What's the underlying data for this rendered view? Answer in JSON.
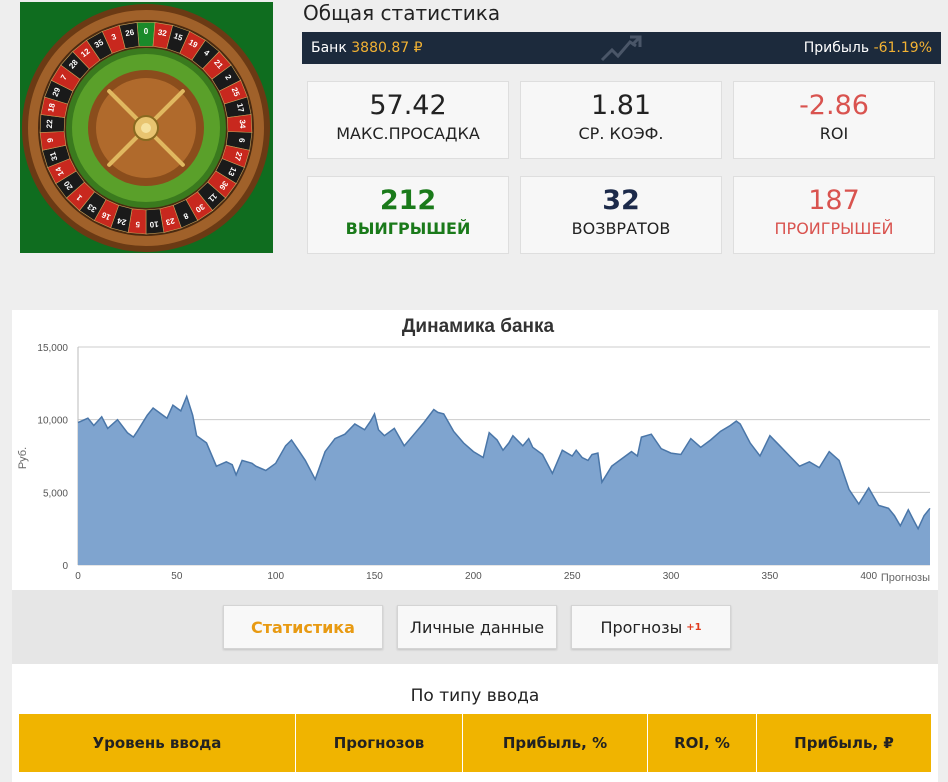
{
  "header": {
    "title": "Общая статистика",
    "bank_label": "Банк",
    "bank_value": "3880.87 ₽",
    "profit_label": "Прибыль",
    "profit_value": "-61.19%"
  },
  "stats": [
    {
      "value": "57.42",
      "label": "МАКС.ПРОСАДКА",
      "color": "#222222"
    },
    {
      "value": "1.81",
      "label": "СР. КОЭФ.",
      "color": "#222222"
    },
    {
      "value": "-2.86",
      "label": "ROI",
      "color": "#d9534f"
    },
    {
      "value": "212",
      "label": "ВЫИГРЫШЕЙ",
      "color": "#1a7a1a"
    },
    {
      "value": "32",
      "label": "ВОЗВРАТОВ",
      "color": "#1c2a4a"
    },
    {
      "value": "187",
      "label": "ПРОИГРЫШЕЙ",
      "color": "#d9534f"
    }
  ],
  "avatar": {
    "numbers": [
      "0",
      "32",
      "15",
      "19",
      "4",
      "21",
      "2",
      "25",
      "17",
      "34",
      "6",
      "27",
      "13",
      "36",
      "11",
      "30",
      "8",
      "23",
      "10",
      "5",
      "24",
      "16",
      "33",
      "1",
      "20",
      "14",
      "31",
      "9",
      "22",
      "18",
      "29",
      "7",
      "28",
      "12",
      "35",
      "3",
      "26"
    ]
  },
  "chart_data": {
    "type": "area",
    "title": "Динамика банка",
    "xlabel": "Прогнозы",
    "ylabel": "Руб.",
    "xlim": [
      0,
      431
    ],
    "ylim": [
      0,
      15000
    ],
    "x_ticks": [
      "0",
      "50",
      "100",
      "150",
      "200",
      "250",
      "300",
      "350",
      "400"
    ],
    "y_ticks": [
      "0",
      "5,000",
      "10,000",
      "15,000"
    ],
    "series": [
      {
        "x": [
          0,
          5,
          8,
          12,
          15,
          20,
          25,
          28,
          30,
          35,
          38,
          42,
          45,
          48,
          52,
          55,
          58,
          60,
          62,
          65,
          70,
          75,
          78,
          80,
          83,
          88,
          90,
          95,
          100,
          105,
          108,
          112,
          115,
          120,
          125,
          130,
          135,
          140,
          145,
          148,
          150,
          152,
          155,
          160,
          165,
          170,
          175,
          180,
          182,
          185,
          190,
          195,
          200,
          205,
          208,
          212,
          215,
          218,
          220,
          225,
          228,
          230,
          235,
          240,
          245,
          250,
          252,
          255,
          258,
          260,
          263,
          265,
          270,
          275,
          280,
          283,
          285,
          290,
          295,
          300,
          305,
          310,
          315,
          320,
          325,
          330,
          333,
          335,
          340,
          345,
          350,
          355,
          360,
          365,
          370,
          375,
          380,
          385,
          390,
          395,
          400,
          405,
          410,
          413,
          416,
          420,
          423,
          425,
          428,
          431
        ],
        "values": [
          9800,
          10100,
          9600,
          10200,
          9400,
          10000,
          9100,
          8800,
          9200,
          10300,
          10800,
          10400,
          10100,
          11000,
          10600,
          11600,
          10300,
          8900,
          8700,
          8400,
          6800,
          7100,
          6900,
          6200,
          7200,
          7000,
          6800,
          6500,
          7000,
          8200,
          8600,
          7800,
          7200,
          5900,
          7800,
          8700,
          9000,
          9700,
          9300,
          9900,
          10400,
          9300,
          8900,
          9400,
          8200,
          9000,
          9800,
          10700,
          10500,
          10400,
          9200,
          8400,
          7800,
          7400,
          9100,
          8600,
          7900,
          8400,
          8900,
          8200,
          8700,
          8100,
          7600,
          6300,
          7900,
          7500,
          7900,
          7400,
          7200,
          7600,
          7700,
          5700,
          6800,
          7300,
          7800,
          7500,
          8800,
          9000,
          8000,
          7700,
          7600,
          8700,
          8100,
          8600,
          9200,
          9600,
          9900,
          9700,
          8400,
          7500,
          8900,
          8200,
          7500,
          6800,
          7100,
          6700,
          7800,
          7200,
          5200,
          4200,
          5300,
          4100,
          3900,
          3400,
          2700,
          3800,
          3000,
          2500,
          3400,
          3900
        ]
      }
    ]
  },
  "tabs": [
    {
      "label": "Статистика",
      "badge": ""
    },
    {
      "label": "Личные данные",
      "badge": ""
    },
    {
      "label": "Прогнозы",
      "badge": "+1"
    }
  ],
  "table": {
    "section_title": "По типу ввода",
    "columns": [
      "Уровень ввода",
      "Прогнозов",
      "Прибыль, %",
      "ROI, %",
      "Прибыль, ₽"
    ]
  },
  "colors": {
    "accent": "#f0b400",
    "area_fill": "#7fa4cf",
    "area_line": "#4a76a8",
    "dark_bar": "#1c2a3c"
  }
}
